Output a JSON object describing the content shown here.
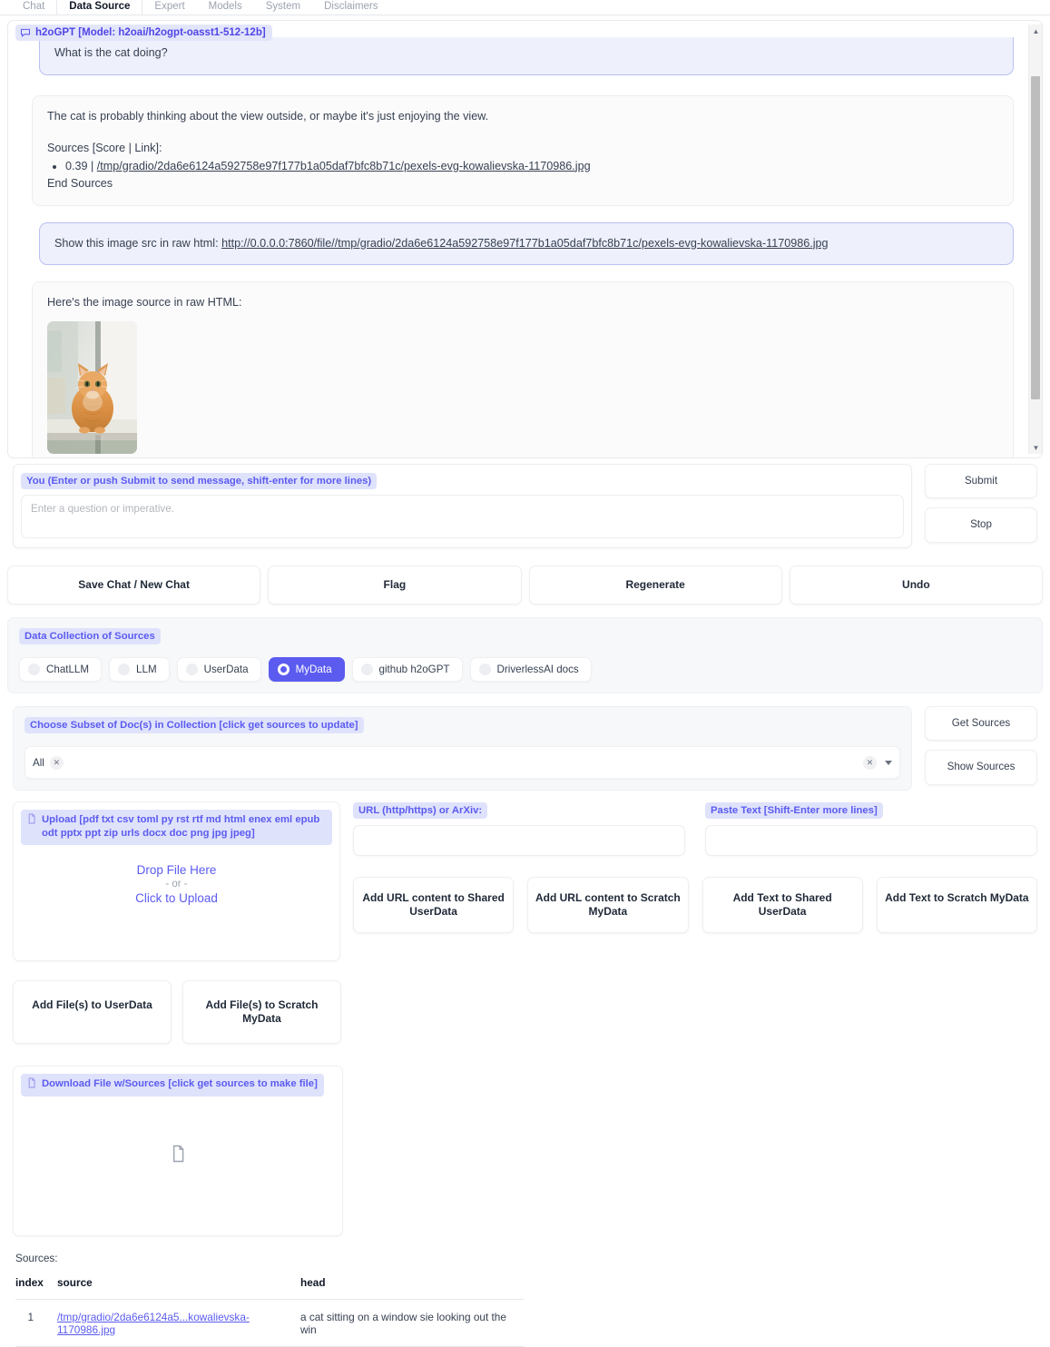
{
  "tabs": [
    {
      "label": "Chat",
      "active": false
    },
    {
      "label": "Data Source",
      "active": true
    },
    {
      "label": "Expert",
      "active": false
    },
    {
      "label": "Models",
      "active": false
    },
    {
      "label": "System",
      "active": false
    },
    {
      "label": "Disclaimers",
      "active": false
    }
  ],
  "chat": {
    "header_label": "h2oGPT [Model: h2oai/h2ogpt-oasst1-512-12b]",
    "messages": [
      {
        "role": "user",
        "text": "What is the cat doing?"
      },
      {
        "role": "bot",
        "text": "The cat is probably thinking about the view outside, or maybe it's just enjoying the view.",
        "sources_header": "Sources [Score | Link]:",
        "source_score": "0.39 | ",
        "source_link": "/tmp/gradio/2da6e6124a592758e97f177b1a05daf7bfc8b71c/pexels-evg-kowalievska-1170986.jpg",
        "end_sources": "End Sources"
      },
      {
        "role": "user",
        "prefix": "Show this image src in raw html: ",
        "link": "http://0.0.0.0:7860/file//tmp/gradio/2da6e6124a592758e97f177b1a05daf7bfc8b71c/pexels-evg-kowalievska-1170986.jpg"
      },
      {
        "role": "bot",
        "text": "Here's the image source in raw HTML:",
        "image_alt": "orange tabby cat sitting on a window sill"
      }
    ]
  },
  "composer": {
    "label": "You (Enter or push Submit to send message, shift-enter for more lines)",
    "placeholder": "Enter a question or imperative.",
    "value": "",
    "submit_label": "Submit",
    "stop_label": "Stop"
  },
  "actions": [
    {
      "label": "Save Chat / New Chat"
    },
    {
      "label": "Flag"
    },
    {
      "label": "Regenerate"
    },
    {
      "label": "Undo"
    }
  ],
  "collection": {
    "label": "Data Collection of Sources",
    "options": [
      {
        "label": "ChatLLM",
        "selected": false
      },
      {
        "label": "LLM",
        "selected": false
      },
      {
        "label": "UserData",
        "selected": false
      },
      {
        "label": "MyData",
        "selected": true
      },
      {
        "label": "github h2oGPT",
        "selected": false
      },
      {
        "label": "DriverlessAI docs",
        "selected": false
      }
    ]
  },
  "subset": {
    "label": "Choose Subset of Doc(s) in Collection [click get sources to update]",
    "chips": [
      "All"
    ],
    "get_sources_label": "Get Sources",
    "show_sources_label": "Show Sources"
  },
  "upload": {
    "label": "Upload [pdf txt csv toml py rst rtf md html enex eml epub odt pptx ppt zip urls docx doc png jpg jpeg]",
    "drop_text": "Drop File Here",
    "or_text": "- or -",
    "click_text": "Click to Upload"
  },
  "url_input": {
    "label": "URL (http/https) or ArXiv:",
    "value": ""
  },
  "paste_text": {
    "label": "Paste Text [Shift-Enter more lines]",
    "value": ""
  },
  "add_buttons": [
    {
      "label": "Add URL content to Shared UserData"
    },
    {
      "label": "Add URL content to Scratch MyData"
    },
    {
      "label": "Add Text to Shared UserData"
    },
    {
      "label": "Add Text to Scratch MyData"
    }
  ],
  "add_file_buttons": [
    {
      "label": "Add File(s) to UserData"
    },
    {
      "label": "Add File(s) to Scratch MyData"
    }
  ],
  "download": {
    "label": "Download File w/Sources [click get sources to make file]"
  },
  "sources_table": {
    "title": "Sources:",
    "columns": [
      "index",
      "source",
      "head"
    ],
    "rows": [
      {
        "index": "1",
        "source": "/tmp/gradio/2da6e6124a5...kowalievska-1170986.jpg",
        "head": "a cat sitting on a window sie looking out the win"
      }
    ]
  },
  "colors": {
    "accent": "#5b5bf0",
    "label_bg": "#dfe2fb",
    "user_bubble_bg": "#eef0fc",
    "user_bubble_border": "#b9c1f2",
    "panel_bg": "#f7f8fa"
  }
}
